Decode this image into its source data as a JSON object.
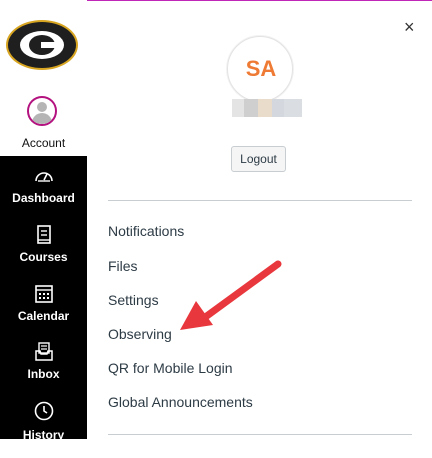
{
  "nav": {
    "account_label": "Account",
    "items": [
      {
        "label": "Dashboard",
        "icon": "dashboard-icon"
      },
      {
        "label": "Courses",
        "icon": "book-icon"
      },
      {
        "label": "Calendar",
        "icon": "calendar-icon"
      },
      {
        "label": "Inbox",
        "icon": "inbox-icon"
      },
      {
        "label": "History",
        "icon": "clock-icon"
      }
    ]
  },
  "panel": {
    "close_symbol": "×",
    "avatar_initials": "SA",
    "logout_label": "Logout",
    "links": [
      {
        "label": "Notifications"
      },
      {
        "label": "Files"
      },
      {
        "label": "Settings"
      },
      {
        "label": "Observing"
      },
      {
        "label": "QR for Mobile Login"
      },
      {
        "label": "Global Announcements"
      }
    ]
  },
  "colors": {
    "nav_bg": "#000000",
    "initials": "#ee7a33",
    "annotation_arrow": "#e8383d",
    "account_ring": "#b3127f"
  }
}
